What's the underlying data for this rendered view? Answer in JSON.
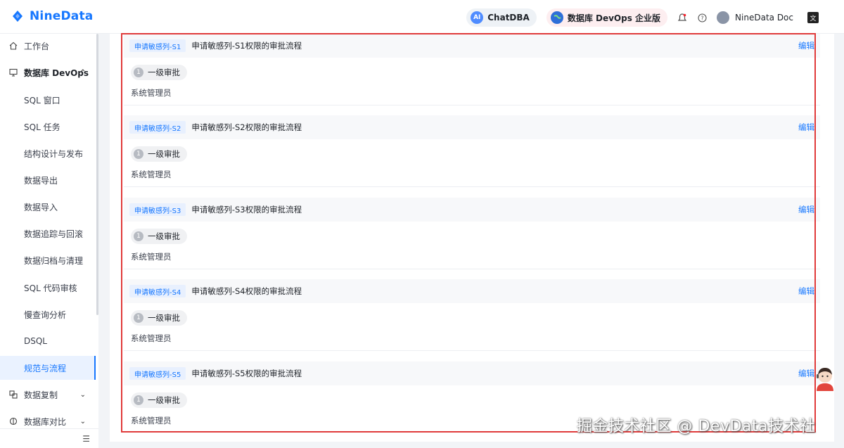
{
  "header": {
    "logo_text": "NineData",
    "chatdba_label": "ChatDBA",
    "chatdba_badge": "AI",
    "devops_label": "数据库 DevOps 企业版",
    "doc_label": "NineData Doc",
    "translate_glyph": "文"
  },
  "sidebar": {
    "items": [
      {
        "label": "工作台",
        "icon": "home-icon"
      },
      {
        "label": "数据库 DevOps",
        "icon": "monitor-icon",
        "expanded": true
      },
      {
        "label": "SQL 窗口"
      },
      {
        "label": "SQL 任务"
      },
      {
        "label": "结构设计与发布"
      },
      {
        "label": "数据导出"
      },
      {
        "label": "数据导入"
      },
      {
        "label": "数据追踪与回滚"
      },
      {
        "label": "数据归档与清理"
      },
      {
        "label": "SQL 代码审核"
      },
      {
        "label": "慢查询分析"
      },
      {
        "label": "DSQL"
      },
      {
        "label": "规范与流程",
        "active": true
      },
      {
        "label": "数据复制",
        "icon": "replicate-icon"
      },
      {
        "label": "数据库对比",
        "icon": "compare-icon"
      }
    ]
  },
  "flows": [
    {
      "tag": "申请敏感列-S1",
      "title": "申请敏感列-S1权限的审批流程",
      "edit": "编辑",
      "step_num": "1",
      "step_label": "一级审批",
      "approver": "系统管理员"
    },
    {
      "tag": "申请敏感列-S2",
      "title": "申请敏感列-S2权限的审批流程",
      "edit": "编辑",
      "step_num": "1",
      "step_label": "一级审批",
      "approver": "系统管理员"
    },
    {
      "tag": "申请敏感列-S3",
      "title": "申请敏感列-S3权限的审批流程",
      "edit": "编辑",
      "step_num": "1",
      "step_label": "一级审批",
      "approver": "系统管理员"
    },
    {
      "tag": "申请敏感列-S4",
      "title": "申请敏感列-S4权限的审批流程",
      "edit": "编辑",
      "step_num": "1",
      "step_label": "一级审批",
      "approver": "系统管理员"
    },
    {
      "tag": "申请敏感列-S5",
      "title": "申请敏感列-S5权限的审批流程",
      "edit": "编辑",
      "step_num": "1",
      "step_label": "一级审批",
      "approver": "系统管理员"
    }
  ],
  "watermark": "掘金技术社区 @ DevData技术社",
  "colors": {
    "accent": "#1677ff",
    "highlight": "#e03a3a"
  }
}
